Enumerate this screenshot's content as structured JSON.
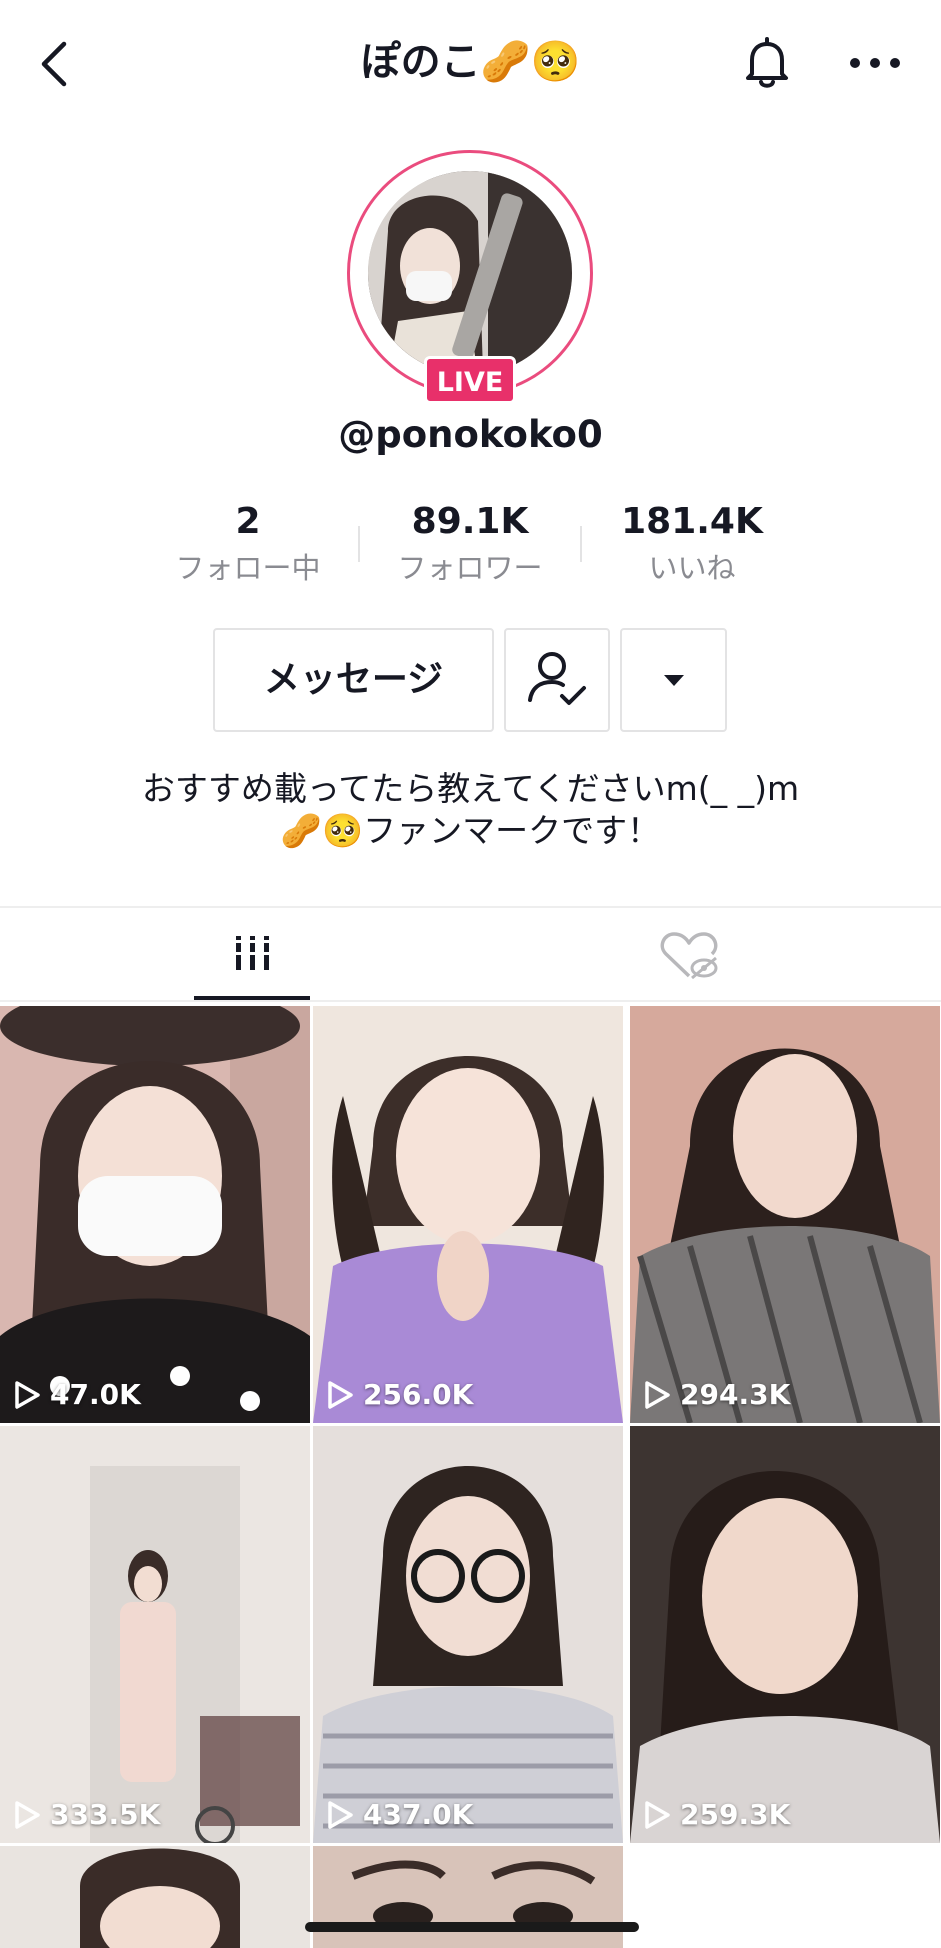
{
  "header": {
    "title": "ぽのこ🥜🥺",
    "icons": [
      "back-arrow-icon",
      "bell-icon",
      "more-dots-icon"
    ]
  },
  "profile": {
    "live_label": "LIVE",
    "handle": "@ponokoko0",
    "stats": [
      {
        "value": "2",
        "label": "フォロー中"
      },
      {
        "value": "89.1K",
        "label": "フォロワー"
      },
      {
        "value": "181.4K",
        "label": "いいね"
      }
    ],
    "message_button": "メッセージ",
    "bio_line1": "おすすめ載ってたら教えてくださいm(_ _)m",
    "bio_line2": "🥜🥺ファンマークです！"
  },
  "tabs": [
    "videos-grid-icon",
    "liked-hidden-icon"
  ],
  "videos": [
    {
      "views": "47.0K"
    },
    {
      "views": "256.0K"
    },
    {
      "views": "294.3K"
    },
    {
      "views": "333.5K"
    },
    {
      "views": "437.0K"
    },
    {
      "views": "259.3K"
    }
  ],
  "colors": {
    "live_pink": "#e8306a",
    "ring_pink": "#ea4c7e",
    "text": "#161823",
    "muted": "#8a8b91"
  }
}
